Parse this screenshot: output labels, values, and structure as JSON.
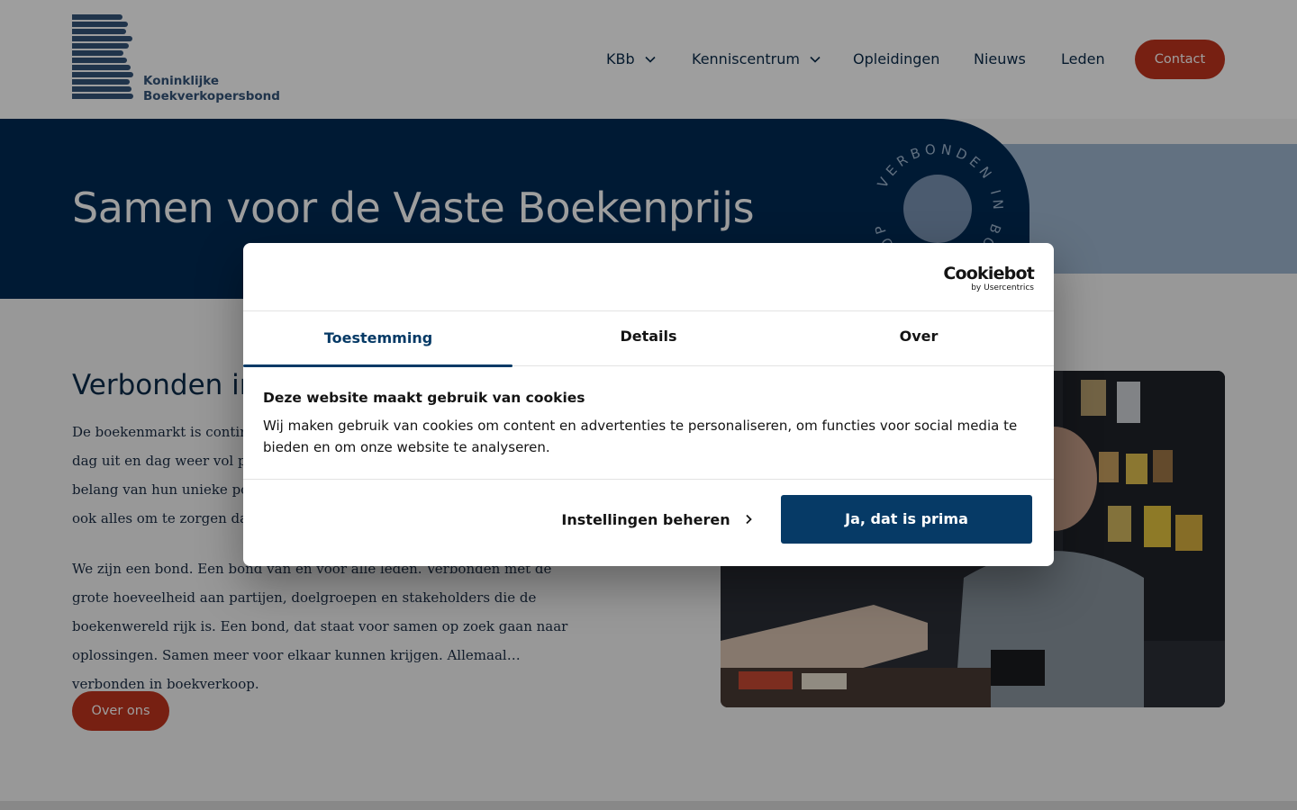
{
  "header": {
    "logo": {
      "line1": "Koninklijke",
      "line2": "Boekverkopersbond"
    },
    "nav": [
      {
        "label": "KBb",
        "has_dropdown": true
      },
      {
        "label": "Kenniscentrum",
        "has_dropdown": true
      },
      {
        "label": "Opleidingen",
        "has_dropdown": false
      },
      {
        "label": "Nieuws",
        "has_dropdown": false
      },
      {
        "label": "Leden",
        "has_dropdown": false
      }
    ],
    "contact_label": "Contact"
  },
  "hero": {
    "title": "Samen voor de Vaste Boekenprijs",
    "badge_text": "VERBONDEN IN BOEKVERKOOP"
  },
  "content": {
    "heading": "Verbonden in boekverkoop",
    "paragraph1": "De boekenmarkt is continu in beweging. Boekverkopers staan dag in, dag uit en dag weer vol passie. Bij de KBb zijn we ons bewust van het belang van hun unieke positie in de boekenketen. En daarom doen we ook alles om te zorgen dat die positie sterk blijft.",
    "paragraph2": "We zijn een bond. Een bond van en voor alle leden. Verbonden met de grote hoeveelheid aan partijen, doelgroepen en stakeholders die de boekenwereld rijk is. Een bond, dat staat voor samen op zoek gaan naar oplossingen. Samen meer voor elkaar kunnen krijgen. Allemaal… verbonden in boekverkoop.",
    "button_label": "Over ons"
  },
  "cookie_dialog": {
    "brand": "Cookiebot",
    "brand_sub": "by Usercentrics",
    "tabs": [
      {
        "label": "Toestemming",
        "active": true
      },
      {
        "label": "Details",
        "active": false
      },
      {
        "label": "Over",
        "active": false
      }
    ],
    "title": "Deze website maakt gebruik van cookies",
    "body": "Wij maken gebruik van cookies om content en advertenties te personaliseren, om functies voor social media te bieden en om onze website te analyseren.",
    "manage_label": "Instellingen beheren",
    "accept_label": "Ja, dat is prima"
  },
  "colors": {
    "navy": "#002b54",
    "accent_red": "#c0341d",
    "cookie_blue": "#063a66",
    "light_blue": "#9fb6d1"
  },
  "icons": [
    "chevron-down-icon",
    "chevron-right-icon"
  ]
}
